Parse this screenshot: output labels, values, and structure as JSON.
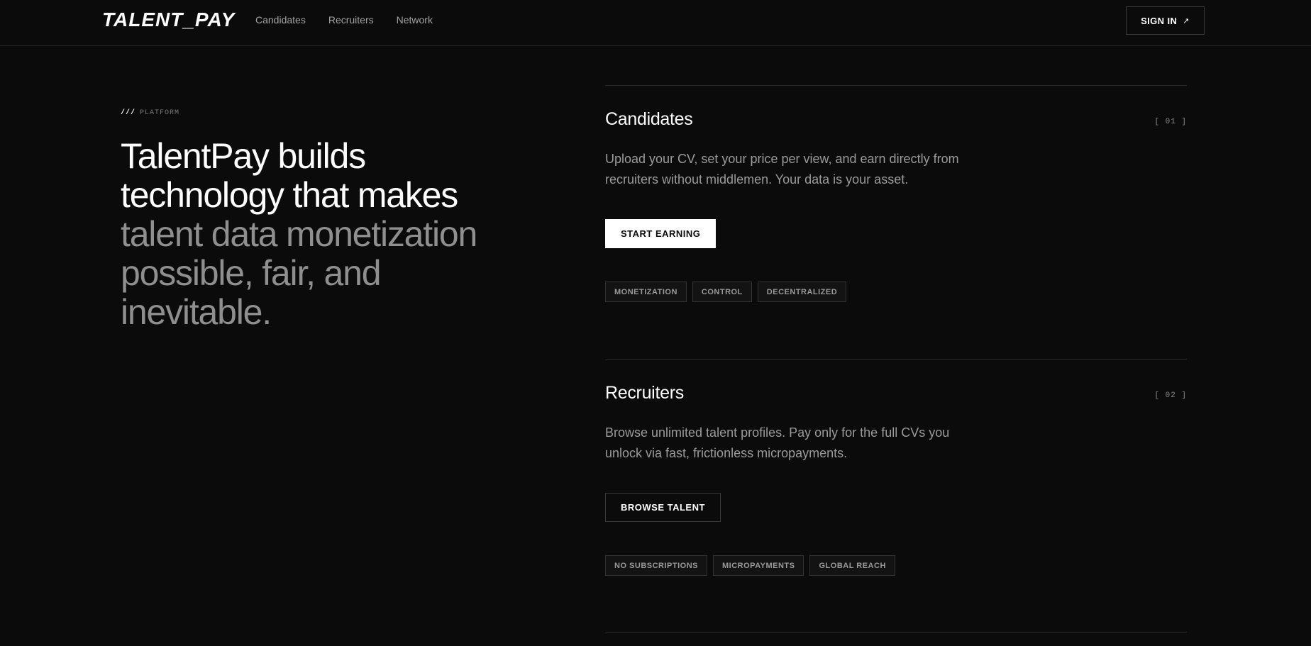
{
  "header": {
    "logo": "TALENT_PAY",
    "nav": [
      "Candidates",
      "Recruiters",
      "Network"
    ],
    "signin_label": "SIGN IN",
    "signin_icon": "arrow-up-right-icon"
  },
  "hero": {
    "eyebrow_slashes": "///",
    "eyebrow": "PLATFORM",
    "headline_bright": "TalentPay builds technology that makes",
    "headline_dim": "talent data monetization possible, fair, and inevitable."
  },
  "sections": [
    {
      "title": "Candidates",
      "number": "[ 01 ]",
      "description": "Upload your CV, set your price per view, and earn directly from recruiters without middlemen. Your data is your asset.",
      "cta": "START EARNING",
      "tags": [
        "MONETIZATION",
        "CONTROL",
        "DECENTRALIZED"
      ]
    },
    {
      "title": "Recruiters",
      "number": "[ 02 ]",
      "description": "Browse unlimited talent profiles. Pay only for the full CVs you unlock via fast, frictionless micropayments.",
      "cta": "BROWSE TALENT",
      "tags": [
        "NO SUBSCRIPTIONS",
        "MICROPAYMENTS",
        "GLOBAL REACH"
      ]
    }
  ],
  "colors": {
    "background": "#0b0b0b",
    "text_primary": "#ffffff",
    "text_muted": "#8f8f8f",
    "border": "#2a2a2a"
  }
}
